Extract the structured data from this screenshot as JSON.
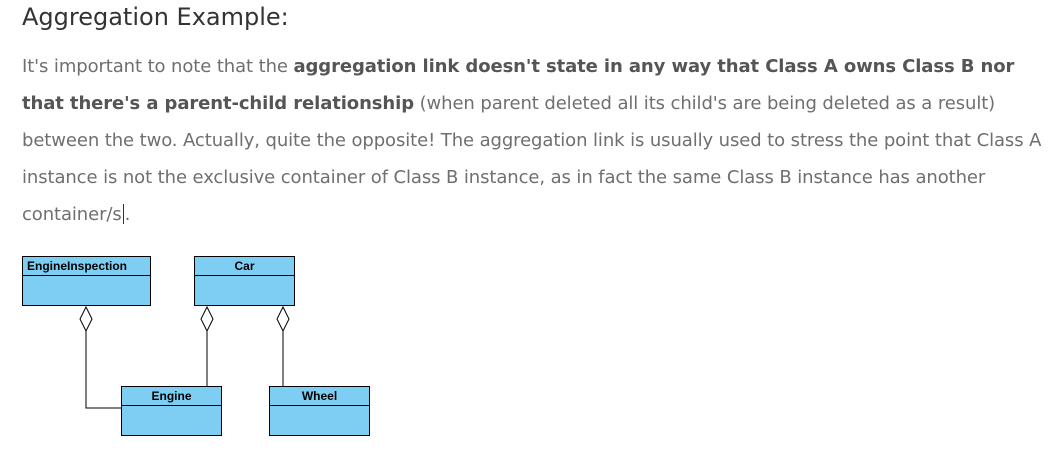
{
  "heading": "Aggregation Example:",
  "paragraph": {
    "seg1": "It's important to note that the ",
    "bold1": "aggregation link doesn't state in any way that Class A owns Class B nor that there's a parent-child relationship",
    "seg2": " (when parent deleted all its child's are being deleted as a result) between the two. Actually, quite the opposite! The aggregation link is usually used to stress the point that Class A instance is not the exclusive container of Class B instance, as in fact the same Class B instance has another container/s",
    "seg3": "."
  },
  "diagram": {
    "classes": {
      "engine_inspection": "EngineInspection",
      "car": "Car",
      "engine": "Engine",
      "wheel": "Wheel"
    },
    "box_color": "#7ecef4"
  }
}
